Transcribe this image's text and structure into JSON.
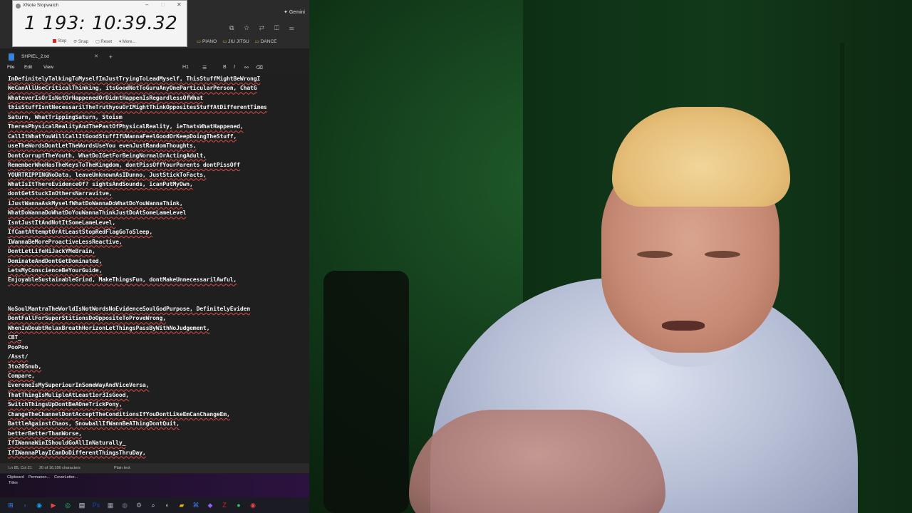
{
  "stopwatch": {
    "title": "XNote Stopwatch",
    "time": "1 193: 10:39.32",
    "buttons": [
      "Stop",
      "Snap",
      "Reset",
      "More..."
    ]
  },
  "browser": {
    "gemini_label": "Gemini",
    "bookmarks": [
      "PIANO",
      "JIU JITSU",
      "DANCE"
    ]
  },
  "notepad": {
    "tab_title": "SHPIEL_2.txt",
    "menu": [
      "File",
      "Edit",
      "View"
    ],
    "format_label": "H1",
    "lines": [
      "ImDefinitelyTalkingToMyselfImJustTryingToLeadMyself, ThisStuffMightBeWrongI",
      "WeCanAllUseCriticalThinking, itsGoodNotToGuruAnyOneParticularPerson,  ChatG",
      "WhateverIsOrIsNotOrHappenedOrDidntHappenIsRegardlessOfWhat",
      "thisStuffIsntNecessarilTheTruthyouOrIMightThinkOppositesStuffAtDifferentTimes",
      "Saturn, WhatTrippingSaturn, Stoism",
      "TheresPhysicalRealityAndThePastOfPhysicalReality, ieThatsWhatHappened,",
      "CallItWhatYouWillCallItGoodStuffIfUWannaFeelGoodOrKeepDoingTheStuff,",
      "useTheWordsDontLetTheWordsUseYou  evenJustRandomThoughts,",
      "DontCorruptTheYouth, WhatDoIGetForBeingNormalOrActingAdult,",
      "RememberWhoHasTheKeysToTheKingdom, dontPissOffYourParents  dontPissOff",
      "YOURTRIPPINGNoData, leaveUnknownAsIDunno, JustStickToFacts,",
      "WhatIsItThereEvidenceOf? sightsAndSounds, icanPutMyOwn,",
      "dontGetStuckInOthersNarravitve,",
      "iJustWannaAskMyselfWhatDoWannaDoWhatDoYouWannaThink,",
      "WhatDoWannaDoWhatDoYouWannaThinkJustDoAtSomeLameLevel",
      "IsntJustItAndNotItSomeLameLevel,",
      "IfCantAttemptOrAtLeastStopRedFlagGoToSleep,",
      "IWannaBeMoreProactiveLessReactive,",
      "DontLetLifeHiJackYMeBrain,",
      "DominateAndDontGetDominated,",
      "LetsMyConscienceBeYourGuide,",
      "EnjoyableSustainableGrind, MakeThingsFun, dontMakeUnnecessarilAwful,",
      "",
      "",
      "NoSoulMantraTheWorldIsNotWordsNoEvidenceSoulGodPurpose, DefinitelyEviden",
      "DontFallForSuperStitionsDoOppositeToProveWrong,",
      "WhenInDoubtRelaxBreathHorizonLetThingsPassByWithNoJudgement,",
      "CBT_",
      "PooPoo",
      "/Asst/",
      "3to20Snub,",
      "Compare,",
      "EveroneIsMySuperiourInSomeWayAndViceVersa,",
      "ThatThingIsMulipleAtLeast1or3IsGood,",
      "SwitchThingsUpDontBeAOneTrickPony,",
      "ChangeTheChannelDontAcceptTheConditionsIfYouDontLikeEmCanChangeEm,",
      "BattleAgainstChaos, SnowballIfWannBeAThingDontQuit,",
      "betterBetterThanWorse,",
      "IfIWannaWinIShouldGoAllInNaturally_",
      "IfIWannaPlayICanDoDifferentThingsThruDay,"
    ],
    "status": {
      "position": "Ln 85, Col 21",
      "chars": "20 of 16,106 characters",
      "format": "Plain text"
    }
  },
  "clipboard": {
    "label": "Clipboard",
    "items": [
      "Permanen...",
      "CoverLetter..."
    ],
    "titles_label": "Titles"
  },
  "taskbar": {
    "icons": [
      "windows-start",
      "terminal",
      "edge",
      "media",
      "chrome",
      "file",
      "photoshop",
      "notepad",
      "obs",
      "settings",
      "search",
      "app",
      "folder",
      "vscode",
      "app2",
      "filezilla",
      "app3",
      "app4"
    ]
  },
  "colors": {
    "editor_bg": "#1f1f1f",
    "webcam_wall": "#143f1c",
    "stopwatch_bg": "#f4f4f4"
  }
}
